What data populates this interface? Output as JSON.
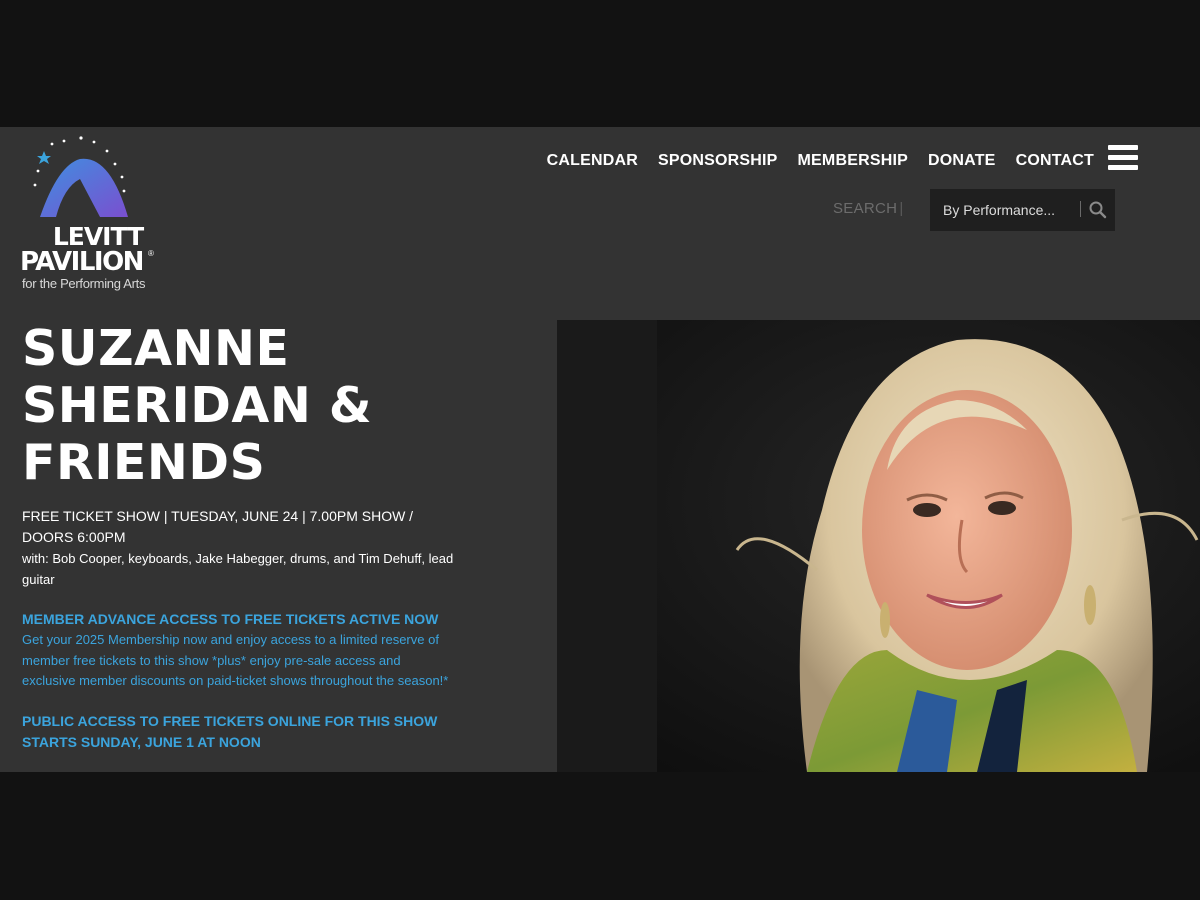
{
  "site": {
    "logo": {
      "line1": "LEVITT",
      "line2": "PAVILION",
      "registered": "®",
      "tagline": "for the Performing Arts"
    },
    "nav": [
      {
        "label": "CALENDAR"
      },
      {
        "label": "SPONSORSHIP"
      },
      {
        "label": "MEMBERSHIP"
      },
      {
        "label": "DONATE"
      },
      {
        "label": "CONTACT"
      }
    ],
    "menu_icon": "hamburger-icon",
    "search": {
      "label": "SEARCH",
      "separator": "|",
      "placeholder": "By Performance...",
      "icon": "search-icon"
    }
  },
  "event": {
    "title_lines": [
      "SUZANNE",
      "SHERIDAN &",
      "FRIENDS"
    ],
    "details": "FREE TICKET SHOW | TUESDAY, JUNE 24 | 7.00PM SHOW / DOORS 6:00PM",
    "with": "with: Bob Cooper, keyboards, Jake Habegger, drums, and Tim Dehuff, lead guitar",
    "member_heading": "MEMBER ADVANCE ACCESS TO FREE TICKETS ACTIVE NOW",
    "member_body": "Get your 2025 Membership now and enjoy access to a limited reserve of member free tickets to this show *plus* enjoy pre-sale access and exclusive member discounts on paid-ticket shows throughout the season!*",
    "public_heading": "PUBLIC ACCESS TO FREE TICKETS ONLINE FOR THIS SHOW STARTS SUNDAY, JUNE 1 AT NOON"
  },
  "colors": {
    "background": "#333333",
    "letterbox": "#121212",
    "accent_blue": "#3ba4dd",
    "text": "#ffffff"
  }
}
